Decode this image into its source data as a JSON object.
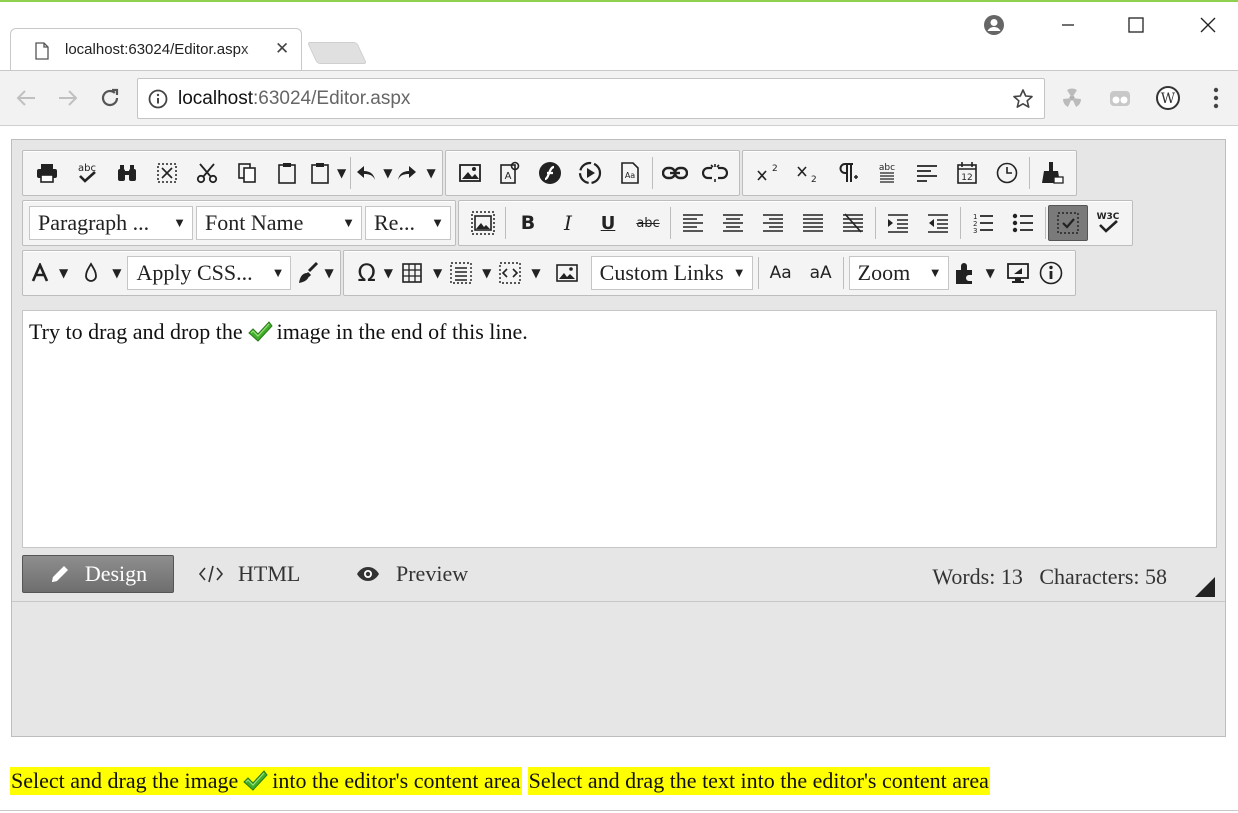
{
  "browser": {
    "tab_title": "localhost:63024/Editor.aspx",
    "url_host": "localhost",
    "url_path": ":63024/Editor.aspx"
  },
  "toolbar": {
    "paragraph_select": "Paragraph ...",
    "font_name_select": "Font Name",
    "font_size_select": "Re...",
    "apply_css_select": "Apply CSS...",
    "custom_links_select": "Custom Links",
    "zoom_select": "Zoom",
    "spell_label": "abc",
    "strike_label": "abc",
    "w3c_label": "W3C",
    "font_case_lower": "Aa",
    "font_case_upper": "aA",
    "calendar_label": "12"
  },
  "content": {
    "before_image": "Try to drag and drop the",
    "after_image": "image in the end of this line."
  },
  "modes": {
    "design": "Design",
    "html": "HTML",
    "preview": "Preview"
  },
  "status": {
    "words": "Words: 13",
    "characters": "Characters: 58"
  },
  "drag_sources": {
    "image_before": "Select and drag the image",
    "image_after": "into the editor's content area",
    "text_source": "Select and drag the text into the editor's content area"
  },
  "colors": {
    "highlight": "#ffff00",
    "check_green": "#3fae2a"
  }
}
